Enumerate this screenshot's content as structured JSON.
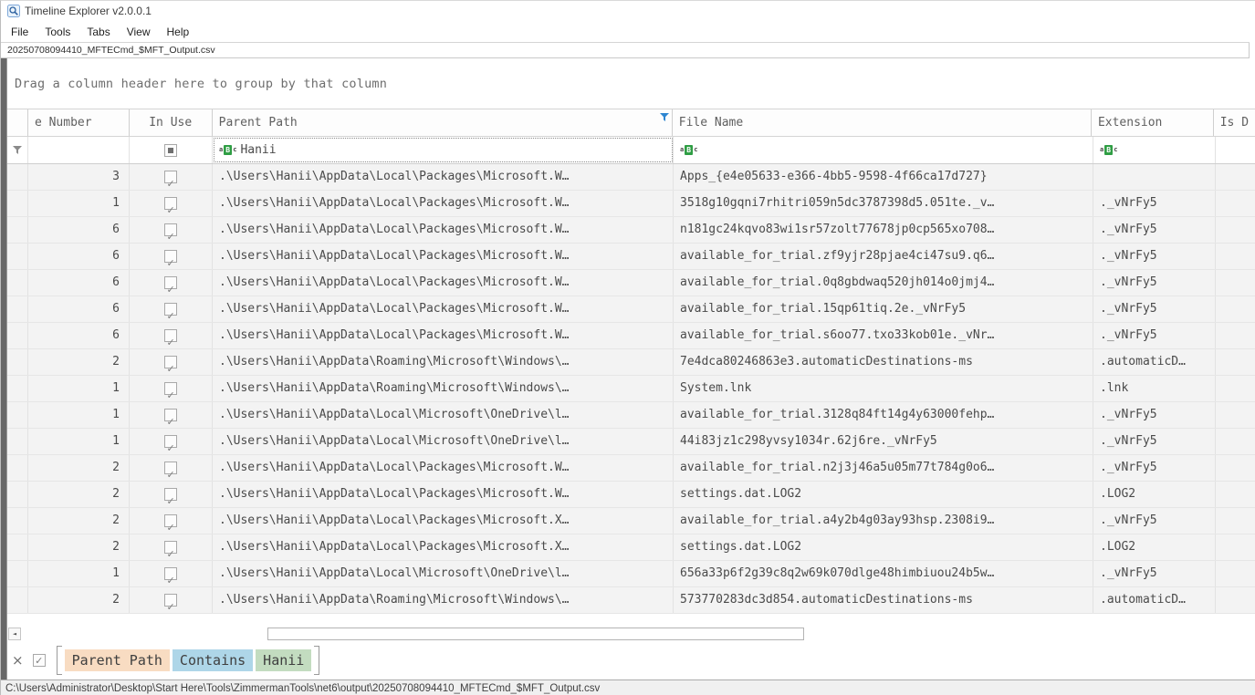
{
  "window": {
    "title": "Timeline Explorer v2.0.0.1"
  },
  "menu": {
    "items": [
      "File",
      "Tools",
      "Tabs",
      "View",
      "Help"
    ]
  },
  "tab": {
    "label": "20250708094410_MFTECmd_$MFT_Output.csv"
  },
  "group_panel": {
    "hint": "Drag a column header here to group by that column"
  },
  "grid": {
    "columns": [
      {
        "label": "e Number"
      },
      {
        "label": "In Use"
      },
      {
        "label": "Parent Path",
        "filtered": true
      },
      {
        "label": "File Name"
      },
      {
        "label": "Extension"
      },
      {
        "label": "Is D"
      }
    ],
    "filter_row": {
      "parent_path": "Hanii",
      "file_name": "",
      "extension": ""
    },
    "rows": [
      {
        "entry": "3",
        "in_use": true,
        "parent_path": ".\\Users\\Hanii\\AppData\\Local\\Packages\\Microsoft.W…",
        "file_name": "Apps_{e4e05633-e366-4bb5-9598-4f66ca17d727}",
        "extension": ""
      },
      {
        "entry": "1",
        "in_use": true,
        "parent_path": ".\\Users\\Hanii\\AppData\\Local\\Packages\\Microsoft.W…",
        "file_name": "3518g10gqni7rhitri059n5dc3787398d5.051te._v…",
        "extension": "._vNrFy5"
      },
      {
        "entry": "6",
        "in_use": true,
        "parent_path": ".\\Users\\Hanii\\AppData\\Local\\Packages\\Microsoft.W…",
        "file_name": "n181gc24kqvo83wi1sr57zolt77678jp0cp565xo708…",
        "extension": "._vNrFy5"
      },
      {
        "entry": "6",
        "in_use": true,
        "parent_path": ".\\Users\\Hanii\\AppData\\Local\\Packages\\Microsoft.W…",
        "file_name": "available_for_trial.zf9yjr28pjae4ci47su9.q6…",
        "extension": "._vNrFy5"
      },
      {
        "entry": "6",
        "in_use": true,
        "parent_path": ".\\Users\\Hanii\\AppData\\Local\\Packages\\Microsoft.W…",
        "file_name": "available_for_trial.0q8gbdwaq520jh014o0jmj4…",
        "extension": "._vNrFy5"
      },
      {
        "entry": "6",
        "in_use": true,
        "parent_path": ".\\Users\\Hanii\\AppData\\Local\\Packages\\Microsoft.W…",
        "file_name": "available_for_trial.15qp61tiq.2e._vNrFy5",
        "extension": "._vNrFy5"
      },
      {
        "entry": "6",
        "in_use": true,
        "parent_path": ".\\Users\\Hanii\\AppData\\Local\\Packages\\Microsoft.W…",
        "file_name": "available_for_trial.s6oo77.txo33kob01e._vNr…",
        "extension": "._vNrFy5"
      },
      {
        "entry": "2",
        "in_use": true,
        "parent_path": ".\\Users\\Hanii\\AppData\\Roaming\\Microsoft\\Windows\\…",
        "file_name": "7e4dca80246863e3.automaticDestinations-ms",
        "extension": ".automaticD…"
      },
      {
        "entry": "1",
        "in_use": true,
        "parent_path": ".\\Users\\Hanii\\AppData\\Roaming\\Microsoft\\Windows\\…",
        "file_name": "System.lnk",
        "extension": ".lnk"
      },
      {
        "entry": "1",
        "in_use": true,
        "parent_path": ".\\Users\\Hanii\\AppData\\Local\\Microsoft\\OneDrive\\l…",
        "file_name": "available_for_trial.3128q84ft14g4y63000fehp…",
        "extension": "._vNrFy5"
      },
      {
        "entry": "1",
        "in_use": true,
        "parent_path": ".\\Users\\Hanii\\AppData\\Local\\Microsoft\\OneDrive\\l…",
        "file_name": "44i83jz1c298yvsy1034r.62j6re._vNrFy5",
        "extension": "._vNrFy5"
      },
      {
        "entry": "2",
        "in_use": true,
        "parent_path": ".\\Users\\Hanii\\AppData\\Local\\Packages\\Microsoft.W…",
        "file_name": "available_for_trial.n2j3j46a5u05m77t784g0o6…",
        "extension": "._vNrFy5"
      },
      {
        "entry": "2",
        "in_use": true,
        "parent_path": ".\\Users\\Hanii\\AppData\\Local\\Packages\\Microsoft.W…",
        "file_name": "settings.dat.LOG2",
        "extension": ".LOG2"
      },
      {
        "entry": "2",
        "in_use": true,
        "parent_path": ".\\Users\\Hanii\\AppData\\Local\\Packages\\Microsoft.X…",
        "file_name": "available_for_trial.a4y2b4g03ay93hsp.2308i9…",
        "extension": "._vNrFy5"
      },
      {
        "entry": "2",
        "in_use": true,
        "parent_path": ".\\Users\\Hanii\\AppData\\Local\\Packages\\Microsoft.X…",
        "file_name": "settings.dat.LOG2",
        "extension": ".LOG2"
      },
      {
        "entry": "1",
        "in_use": true,
        "parent_path": ".\\Users\\Hanii\\AppData\\Local\\Microsoft\\OneDrive\\l…",
        "file_name": "656a33p6f2g39c8q2w69k070dlge48himbiuou24b5w…",
        "extension": "._vNrFy5"
      },
      {
        "entry": "2",
        "in_use": true,
        "parent_path": ".\\Users\\Hanii\\AppData\\Roaming\\Microsoft\\Windows\\…",
        "file_name": "573770283dc3d854.automaticDestinations-ms",
        "extension": ".automaticD…"
      }
    ]
  },
  "filter_panel": {
    "close_label": "×",
    "enabled": true,
    "chips": [
      {
        "label": "Parent Path",
        "color": "#f8dcc2"
      },
      {
        "label": "Contains",
        "color": "#aed6e8"
      },
      {
        "label": "Hanii",
        "color": "#c3dcc0"
      }
    ]
  },
  "status_bar": {
    "path": "C:\\Users\\Administrator\\Desktop\\Start Here\\Tools\\ZimmermanTools\\net6\\output\\20250708094410_MFTECmd_$MFT_Output.csv"
  },
  "icons": {
    "text_filter": "aBc",
    "funnel_active_color": "#2e86d1",
    "funnel_inactive_color": "#8a8a8a"
  }
}
